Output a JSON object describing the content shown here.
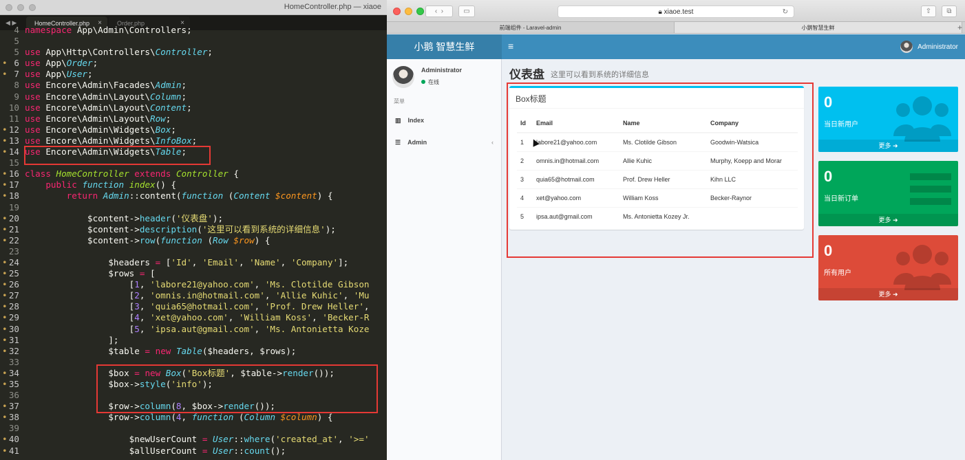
{
  "editor": {
    "window_title": "HomeController.php — xiaoe",
    "tabs": [
      {
        "label": "HomeController.php",
        "close": "×"
      },
      {
        "label": "Order.php",
        "close": "×"
      }
    ],
    "nav_arrows": "◀ ▶",
    "lines": [
      {
        "n": "4",
        "m": false,
        "html": "<span class=\"kw\">namespace</span> <span class=\"pl\">App\\Admin\\Controllers;</span>"
      },
      {
        "n": "5",
        "m": false,
        "html": ""
      },
      {
        "n": "5",
        "m": false,
        "html": "<span class=\"kw\">use</span> <span class=\"pl\">App\\Http\\Controllers\\</span><span class=\"fni\">Controller</span><span class=\"pl\">;</span>"
      },
      {
        "n": "6",
        "m": true,
        "html": "<span class=\"kw\">use</span> <span class=\"pl\">App\\</span><span class=\"fni\">Order</span><span class=\"pl\">;</span>"
      },
      {
        "n": "7",
        "m": true,
        "html": "<span class=\"kw\">use</span> <span class=\"pl\">App\\</span><span class=\"fni\">User</span><span class=\"pl\">;</span>"
      },
      {
        "n": "8",
        "m": false,
        "html": "<span class=\"kw\">use</span> <span class=\"pl\">Encore\\Admin\\Facades\\</span><span class=\"fni\">Admin</span><span class=\"pl\">;</span>"
      },
      {
        "n": "9",
        "m": false,
        "html": "<span class=\"kw\">use</span> <span class=\"pl\">Encore\\Admin\\Layout\\</span><span class=\"fni\">Column</span><span class=\"pl\">;</span>"
      },
      {
        "n": "10",
        "m": false,
        "html": "<span class=\"kw\">use</span> <span class=\"pl\">Encore\\Admin\\Layout\\</span><span class=\"fni\">Content</span><span class=\"pl\">;</span>"
      },
      {
        "n": "11",
        "m": false,
        "html": "<span class=\"kw\">use</span> <span class=\"pl\">Encore\\Admin\\Layout\\</span><span class=\"fni\">Row</span><span class=\"pl\">;</span>"
      },
      {
        "n": "12",
        "m": true,
        "html": "<span class=\"kw\">use</span> <span class=\"pl\">Encore\\Admin\\Widgets\\</span><span class=\"fni\">Box</span><span class=\"pl\">;</span>"
      },
      {
        "n": "13",
        "m": true,
        "html": "<span class=\"kw\">use</span> <span class=\"pl\">Encore\\Admin\\Widgets\\</span><span class=\"fni\">InfoBox</span><span class=\"pl\">;</span>"
      },
      {
        "n": "14",
        "m": true,
        "html": "<span class=\"kw\">use</span> <span class=\"pl\">Encore\\Admin\\Widgets\\</span><span class=\"fni\">Table</span><span class=\"pl\">;</span>"
      },
      {
        "n": "15",
        "m": false,
        "html": ""
      },
      {
        "n": "16",
        "m": true,
        "html": "<span class=\"kw\">class</span> <span class=\"cls\">HomeController</span> <span class=\"kw\">extends</span> <span class=\"cls\">Controller</span> <span class=\"pl\">{</span>"
      },
      {
        "n": "17",
        "m": true,
        "html": "    <span class=\"kw\">public</span> <span class=\"fni\">function</span> <span class=\"cls\">index</span><span class=\"pl\">() {</span>"
      },
      {
        "n": "18",
        "m": true,
        "html": "        <span class=\"kw\">return</span> <span class=\"fni\">Admin</span><span class=\"pl\">::content(</span><span class=\"fni\">function</span> <span class=\"pl\">(</span><span class=\"fni\">Content</span> <span class=\"vr\">$content</span><span class=\"pl\">) {</span>"
      },
      {
        "n": "19",
        "m": false,
        "html": ""
      },
      {
        "n": "20",
        "m": true,
        "html": "            <span class=\"pl\">$content-></span><span class=\"fn\">header</span><span class=\"pl\">(</span><span class=\"st\">'仪表盘'</span><span class=\"pl\">);</span>"
      },
      {
        "n": "21",
        "m": true,
        "html": "            <span class=\"pl\">$content-></span><span class=\"fn\">description</span><span class=\"pl\">(</span><span class=\"st\">'这里可以看到系统的详细信息'</span><span class=\"pl\">);</span>"
      },
      {
        "n": "22",
        "m": true,
        "html": "            <span class=\"pl\">$content-></span><span class=\"fn\">row</span><span class=\"pl\">(</span><span class=\"fni\">function</span> <span class=\"pl\">(</span><span class=\"fni\">Row</span> <span class=\"vr\">$row</span><span class=\"pl\">) {</span>"
      },
      {
        "n": "23",
        "m": false,
        "html": ""
      },
      {
        "n": "24",
        "m": true,
        "html": "                <span class=\"pl\">$headers</span> <span class=\"kw\">=</span> <span class=\"pl\">[</span><span class=\"st\">'Id'</span><span class=\"pl\">, </span><span class=\"st\">'Email'</span><span class=\"pl\">, </span><span class=\"st\">'Name'</span><span class=\"pl\">, </span><span class=\"st\">'Company'</span><span class=\"pl\">];</span>"
      },
      {
        "n": "25",
        "m": true,
        "html": "                <span class=\"pl\">$rows</span> <span class=\"kw\">=</span> <span class=\"pl\">[</span>"
      },
      {
        "n": "26",
        "m": true,
        "html": "                    <span class=\"pl\">[</span><span class=\"nm\">1</span><span class=\"pl\">, </span><span class=\"st\">'labore21@yahoo.com'</span><span class=\"pl\">, </span><span class=\"st\">'Ms. Clotilde Gibson</span>"
      },
      {
        "n": "27",
        "m": true,
        "html": "                    <span class=\"pl\">[</span><span class=\"nm\">2</span><span class=\"pl\">, </span><span class=\"st\">'omnis.in@hotmail.com'</span><span class=\"pl\">, </span><span class=\"st\">'Allie Kuhic'</span><span class=\"pl\">, </span><span class=\"st\">'Mu</span>"
      },
      {
        "n": "28",
        "m": true,
        "html": "                    <span class=\"pl\">[</span><span class=\"nm\">3</span><span class=\"pl\">, </span><span class=\"st\">'quia65@hotmail.com'</span><span class=\"pl\">, </span><span class=\"st\">'Prof. Drew Heller'</span><span class=\"pl\">,</span>"
      },
      {
        "n": "29",
        "m": true,
        "html": "                    <span class=\"pl\">[</span><span class=\"nm\">4</span><span class=\"pl\">, </span><span class=\"st\">'xet@yahoo.com'</span><span class=\"pl\">, </span><span class=\"st\">'William Koss'</span><span class=\"pl\">, </span><span class=\"st\">'Becker-R</span>"
      },
      {
        "n": "30",
        "m": true,
        "html": "                    <span class=\"pl\">[</span><span class=\"nm\">5</span><span class=\"pl\">, </span><span class=\"st\">'ipsa.aut@gmail.com'</span><span class=\"pl\">, </span><span class=\"st\">'Ms. Antonietta Koze</span>"
      },
      {
        "n": "31",
        "m": true,
        "html": "                <span class=\"pl\">];</span>"
      },
      {
        "n": "32",
        "m": true,
        "html": "                <span class=\"pl\">$table</span> <span class=\"kw\">=</span> <span class=\"kw\">new</span> <span class=\"fni\">Table</span><span class=\"pl\">($headers, $rows);</span>"
      },
      {
        "n": "33",
        "m": false,
        "html": ""
      },
      {
        "n": "34",
        "m": true,
        "html": "                <span class=\"pl\">$box</span> <span class=\"kw\">=</span> <span class=\"kw\">new</span> <span class=\"fni\">Box</span><span class=\"pl\">(</span><span class=\"st\">'Box标题'</span><span class=\"pl\">, $table-></span><span class=\"fn\">render</span><span class=\"pl\">());</span>"
      },
      {
        "n": "35",
        "m": true,
        "html": "                <span class=\"pl\">$box-></span><span class=\"fn\">style</span><span class=\"pl\">(</span><span class=\"st\">'info'</span><span class=\"pl\">);</span>"
      },
      {
        "n": "36",
        "m": false,
        "html": ""
      },
      {
        "n": "37",
        "m": true,
        "html": "                <span class=\"pl\">$row-></span><span class=\"fn\">column</span><span class=\"pl\">(</span><span class=\"nm\">8</span><span class=\"pl\">, $box-></span><span class=\"fn\">render</span><span class=\"pl\">());</span>"
      },
      {
        "n": "38",
        "m": true,
        "html": "                <span class=\"pl\">$row-></span><span class=\"fn\">column</span><span class=\"pl\">(</span><span class=\"nm\">4</span><span class=\"pl\">, </span><span class=\"fni\">function</span> <span class=\"pl\">(</span><span class=\"fni\">Column</span> <span class=\"vr\">$column</span><span class=\"pl\">) {</span>"
      },
      {
        "n": "39",
        "m": false,
        "html": ""
      },
      {
        "n": "40",
        "m": true,
        "html": "                    <span class=\"pl\">$newUserCount</span> <span class=\"kw\">=</span> <span class=\"fni\">User</span><span class=\"pl\">::</span><span class=\"fn\">where</span><span class=\"pl\">(</span><span class=\"st\">'created_at'</span><span class=\"pl\">, </span><span class=\"st\">'>='</span>"
      },
      {
        "n": "41",
        "m": true,
        "html": "                    <span class=\"pl\">$allUserCount</span> <span class=\"kw\">=</span> <span class=\"fni\">User</span><span class=\"pl\">::</span><span class=\"fn\">count</span><span class=\"pl\">();</span>"
      }
    ]
  },
  "browser": {
    "url": "xiaoe.test",
    "tabs": [
      {
        "label": "前端组件 - Laravel-admin",
        "active": false
      },
      {
        "label": "小鹅智慧生鲜",
        "active": true
      }
    ],
    "new_tab": "+"
  },
  "app": {
    "logo": "小鹅 智慧生鲜",
    "hamburger": "≡",
    "user_name": "Administrator",
    "sidebar": {
      "user_name": "Administrator",
      "status": "在线",
      "menu_header": "菜单",
      "items": [
        {
          "label": "Index",
          "icon": "bar-chart-icon",
          "glyph": "▥"
        },
        {
          "label": "Admin",
          "icon": "tasks-icon",
          "glyph": "☰",
          "caret": "‹"
        }
      ]
    },
    "content": {
      "title": "仪表盘",
      "description": "这里可以看到系统的详细信息",
      "box": {
        "title": "Box标题",
        "style_color": "#00c0ef",
        "headers": [
          "Id",
          "Email",
          "Name",
          "Company"
        ],
        "rows": [
          [
            "1",
            "labore21@yahoo.com",
            "Ms. Clotilde Gibson",
            "Goodwin-Watsica"
          ],
          [
            "2",
            "omnis.in@hotmail.com",
            "Allie Kuhic",
            "Murphy, Koepp and Morar"
          ],
          [
            "3",
            "quia65@hotmail.com",
            "Prof. Drew Heller",
            "Kihn LLC"
          ],
          [
            "4",
            "xet@yahoo.com",
            "William Koss",
            "Becker-Raynor"
          ],
          [
            "5",
            "ipsa.aut@gmail.com",
            "Ms. Antonietta Kozey Jr.",
            ""
          ]
        ]
      },
      "stat_boxes": [
        {
          "count": "0",
          "label": "当日新用户",
          "more": "更多 ➜",
          "color": "#00c0ef",
          "icon": "users-icon"
        },
        {
          "count": "0",
          "label": "当日新订单",
          "more": "更多 ➜",
          "color": "#00a65a",
          "icon": "list-icon"
        },
        {
          "count": "0",
          "label": "所有用户",
          "more": "更多 ➜",
          "color": "#dd4b39",
          "icon": "users-icon"
        }
      ]
    }
  },
  "colors": {
    "header": "#3c8dbc",
    "logo_bg": "#367fa9",
    "highlight": "#e53935"
  }
}
